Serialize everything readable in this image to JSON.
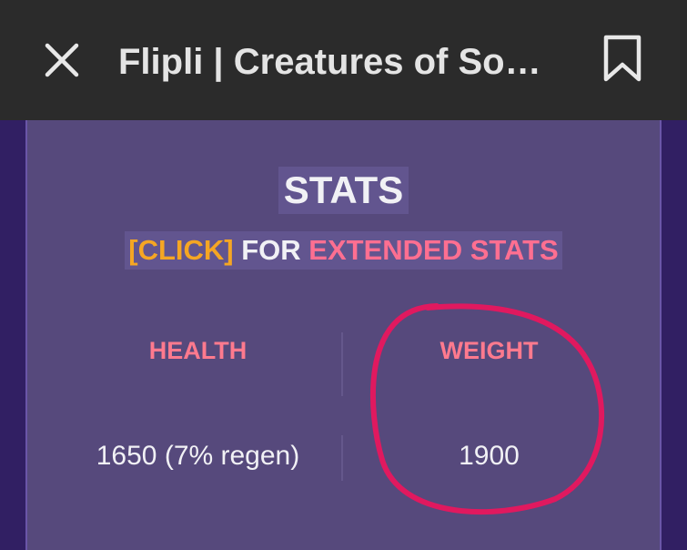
{
  "header": {
    "title": "Flipli | Creatures of So…",
    "close_icon": "close-icon",
    "bookmark_icon": "bookmark-icon"
  },
  "stats": {
    "heading": "STATS",
    "extended": {
      "click": "[CLICK]",
      "for": " FOR ",
      "extended_stats": "EXTENDED STATS"
    },
    "health": {
      "label": "HEALTH",
      "value": "1650 (7% regen)"
    },
    "weight": {
      "label": "WEIGHT",
      "value": "1900"
    }
  },
  "colors": {
    "topbar": "#2b2b2b",
    "panel": "#56497c",
    "accent_orange": "#f5a623",
    "accent_pink": "#ff6f91",
    "annotation_circle": "#e0195f"
  }
}
